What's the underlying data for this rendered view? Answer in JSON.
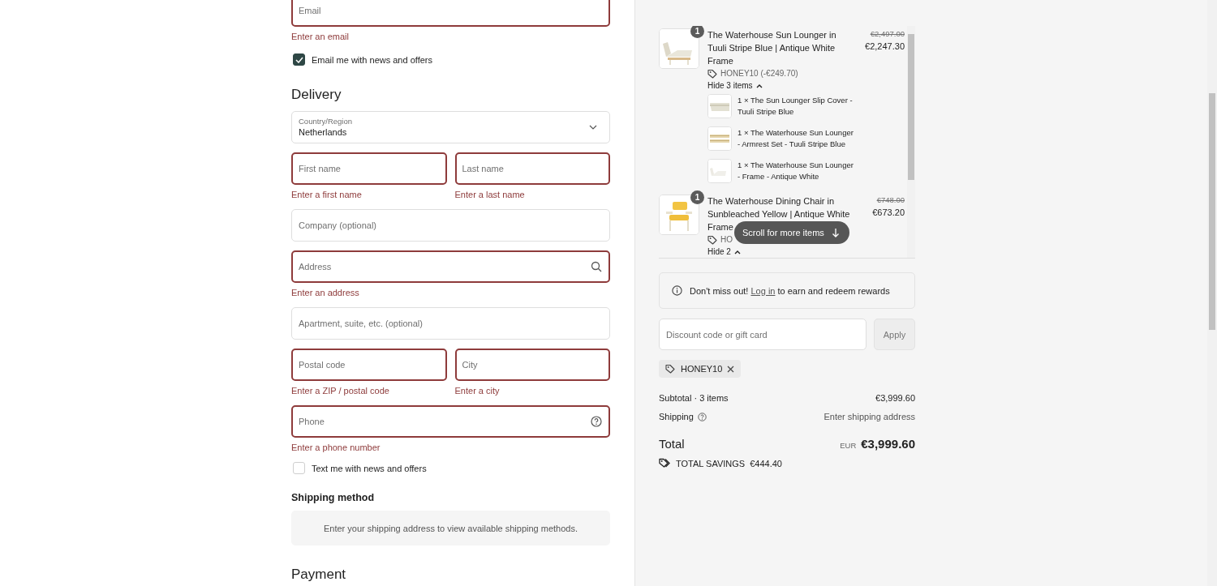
{
  "contact": {
    "email": {
      "kind": "text",
      "placeholder": "Email",
      "invalid": true,
      "error": "Enter an email"
    },
    "newsletter": {
      "label": "Email me with news and offers",
      "checked": true
    }
  },
  "delivery": {
    "heading": "Delivery",
    "rows": [
      {
        "fields": [
          {
            "kind": "select",
            "label": "Country/Region",
            "value": "Netherlands",
            "invalid": false
          }
        ]
      },
      {
        "fields": [
          {
            "kind": "text",
            "placeholder": "First name",
            "invalid": true,
            "error": "Enter a first name"
          },
          {
            "kind": "text",
            "placeholder": "Last name",
            "invalid": true,
            "error": "Enter a last name"
          }
        ]
      },
      {
        "fields": [
          {
            "kind": "text",
            "placeholder": "Company (optional)",
            "invalid": false
          }
        ]
      },
      {
        "fields": [
          {
            "kind": "search",
            "placeholder": "Address",
            "invalid": true,
            "error": "Enter an address"
          }
        ]
      },
      {
        "fields": [
          {
            "kind": "text",
            "placeholder": "Apartment, suite, etc. (optional)",
            "invalid": false
          }
        ]
      },
      {
        "fields": [
          {
            "kind": "text",
            "placeholder": "Postal code",
            "invalid": true,
            "error": "Enter a ZIP / postal code"
          },
          {
            "kind": "text",
            "placeholder": "City",
            "invalid": true,
            "error": "Enter a city"
          }
        ]
      },
      {
        "fields": [
          {
            "kind": "help",
            "placeholder": "Phone",
            "invalid": true,
            "error": "Enter a phone number"
          }
        ]
      }
    ],
    "sms": {
      "label": "Text me with news and offers",
      "checked": false
    }
  },
  "shipping_method": {
    "heading": "Shipping method",
    "message": "Enter your shipping address to view available shipping methods."
  },
  "payment": {
    "heading": "Payment"
  },
  "order": {
    "items": [
      {
        "kind": "lounger",
        "quantity": "1",
        "title": "The Waterhouse Sun Lounger in Tuuli Stripe Blue | Antique White Frame",
        "original_price": "€2,497.00",
        "price": "€2,247.30",
        "discount": "HONEY10 (-€249.70)",
        "toggle": "Hide 3 items",
        "expanded": true,
        "components": [
          {
            "kind": "cover",
            "text": "1 × The Sun Lounger Slip Cover - Tuuli Stripe Blue"
          },
          {
            "kind": "armrest",
            "text": "1 × The Waterhouse Sun Lounger - Armrest Set - Tuuli Stripe Blue"
          },
          {
            "kind": "frame",
            "text": "1 × The Waterhouse Sun Lounger - Frame - Antique White"
          }
        ]
      },
      {
        "kind": "chair",
        "quantity": "1",
        "title": "The Waterhouse Dining Chair in Sunbleached Yellow | Antique White Frame",
        "original_price": "€748.00",
        "price": "€673.20",
        "discount": "HO",
        "toggle": "Hide 2",
        "expanded": true
      }
    ],
    "scroll_hint": "Scroll for more items"
  },
  "rewards": {
    "before": "Don't miss out!",
    "link": "Log in",
    "after": "to earn and redeem rewards"
  },
  "discount": {
    "placeholder": "Discount code or gift card",
    "button": "Apply",
    "disabled": true
  },
  "applied_codes": [
    {
      "code": "HONEY10"
    }
  ],
  "summary": {
    "subtotal_label": "Subtotal · 3 items",
    "subtotal": "€3,999.60",
    "shipping_label": "Shipping",
    "shipping": "Enter shipping address",
    "total_label": "Total",
    "currency": "EUR",
    "total": "€3,999.60",
    "savings_label": "TOTAL SAVINGS",
    "savings": "€444.40"
  }
}
